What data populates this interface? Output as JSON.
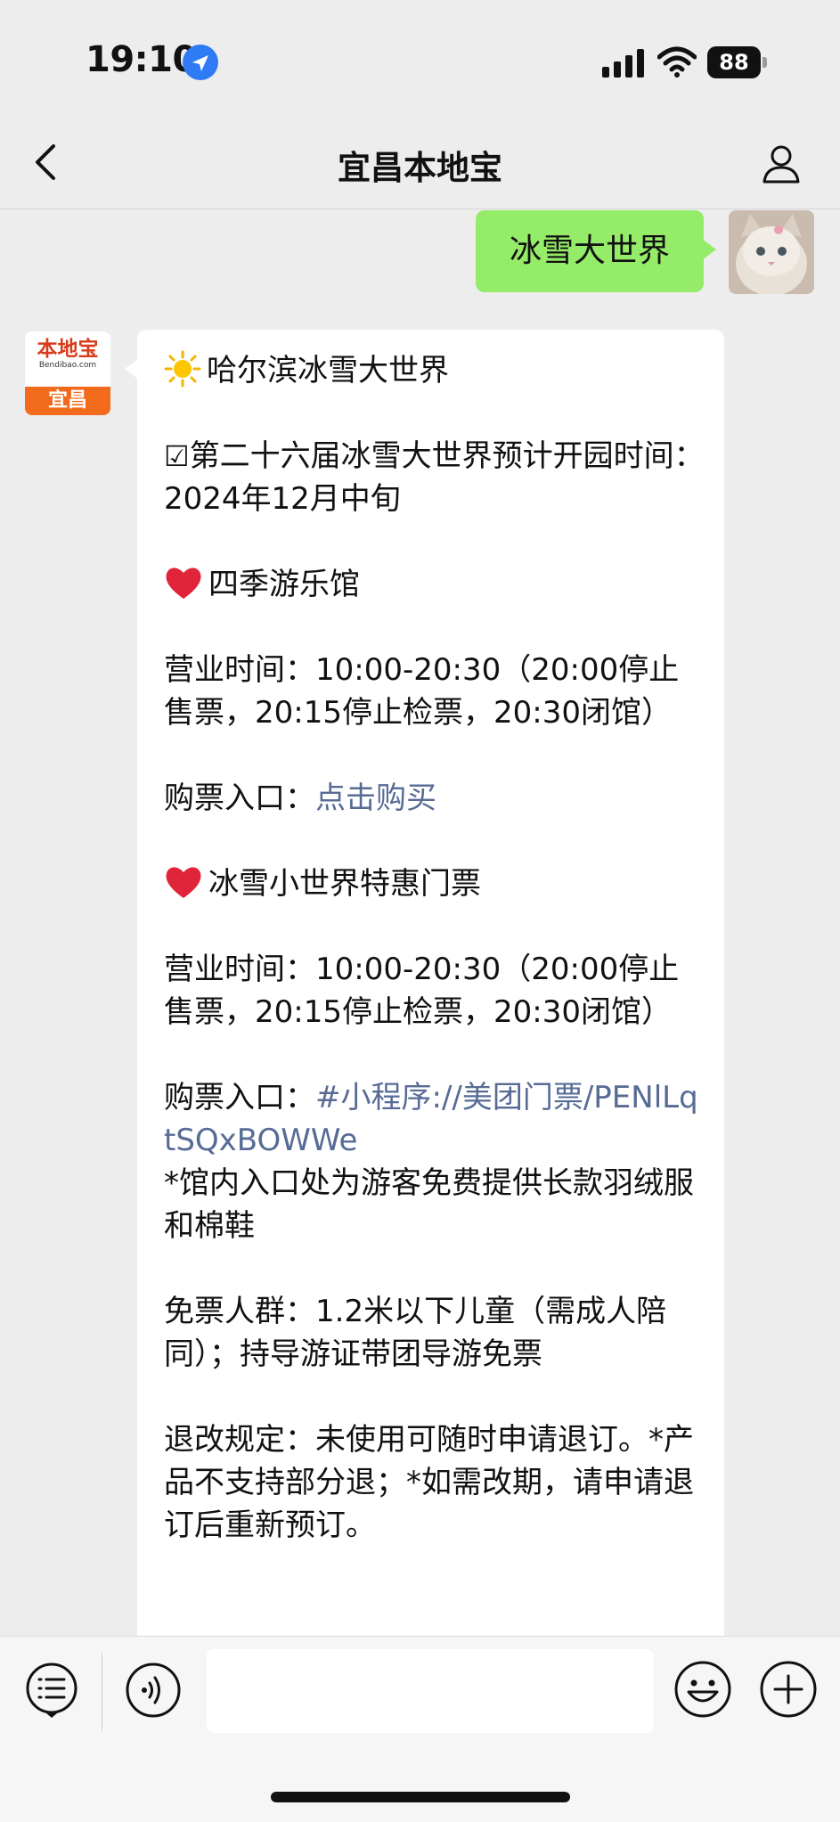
{
  "status_bar": {
    "time": "19:10",
    "battery": "88",
    "icons": [
      "location-arrow-icon",
      "cellular-signal-icon",
      "wifi-icon",
      "battery-icon"
    ]
  },
  "nav": {
    "title": "宜昌本地宝",
    "back_icon": "chevron-left-icon",
    "profile_icon": "person-icon"
  },
  "messages": {
    "outgoing": {
      "text": "冰雪大世界"
    },
    "incoming": {
      "avatar": {
        "brand": "本地宝",
        "url": "Bendibao.com",
        "city": "宜昌"
      },
      "title": "哈尔滨冰雪大世界",
      "check_symbol": "☑",
      "opening_line": "第二十六届冰雪大世界预计开园时间：2024年12月中旬",
      "section1": {
        "heading": "四季游乐馆",
        "hours": "营业时间：10:00-20:30（20:00停止售票，20:15停止检票，20:30闭馆）",
        "ticket_label": "购票入口：",
        "ticket_link": "点击购买"
      },
      "section2": {
        "heading": "冰雪小世界特惠门票",
        "hours": "营业时间：10:00-20:30（20:00停止售票，20:15停止检票，20:30闭馆）",
        "ticket_label": "购票入口：",
        "ticket_link": "#小程序://美团门票/PENlLqtSQxBOWWe",
        "note": "*馆内入口处为游客免费提供长款羽绒服和棉鞋",
        "free": "免票人群：1.2米以下儿童（需成人陪同）；持导游证带团导游免票",
        "refund": "退改规定：未使用可随时申请退订。*产品不支持部分退；*如需改期，请申请退订后重新预订。"
      }
    }
  },
  "colors": {
    "background": "#ededed",
    "outgoing_bubble": "#95ec69",
    "incoming_bubble": "#ffffff",
    "link": "#576b95",
    "brand_orange": "#f26b1d"
  },
  "input_bar": {
    "icons": [
      "list-menu-icon",
      "voice-icon",
      "emoji-icon",
      "plus-icon"
    ],
    "text_value": ""
  }
}
